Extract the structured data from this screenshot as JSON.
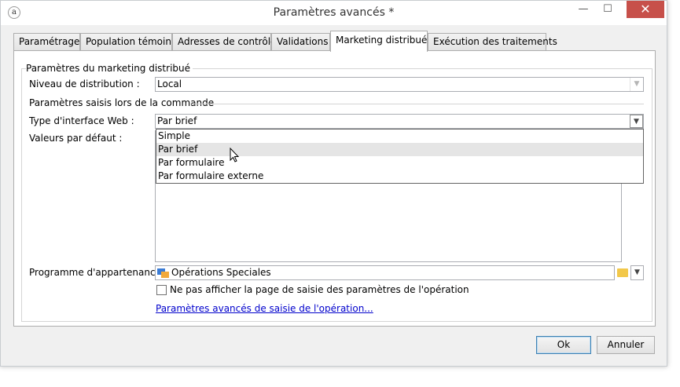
{
  "window": {
    "title": "Paramètres avancés *",
    "close_glyph": "✕",
    "minimize_glyph": "—",
    "maximize_glyph": "☐"
  },
  "tabs": [
    {
      "label": "Paramétrage"
    },
    {
      "label": "Population témoin"
    },
    {
      "label": "Adresses de contrôle"
    },
    {
      "label": "Validations"
    },
    {
      "label": "Marketing distribué",
      "active": true
    },
    {
      "label": "Exécution des traitements"
    }
  ],
  "distributed": {
    "section_title": "Paramètres du marketing distribué",
    "level_label": "Niveau de distribution :",
    "level_value": "Local"
  },
  "order": {
    "section_title": "Paramètres saisis lors de la commande",
    "web_type_label": "Type d'interface Web :",
    "web_type_value": "Par brief",
    "defaults_label": "Valeurs par défaut :",
    "dropdown_options": [
      "Simple",
      "Par brief",
      "Par formulaire",
      "Par formulaire externe"
    ],
    "hovered_option": "Par brief"
  },
  "program": {
    "label": "Programme d'appartenance :",
    "value": "Opérations Speciales"
  },
  "hide_page_checkbox": {
    "label": "Ne pas afficher la page de saisie des paramètres de l'opération",
    "checked": false
  },
  "advanced_link": "Paramètres avancés de saisie de l'opération...",
  "buttons": {
    "ok": "Ok",
    "cancel": "Annuler"
  },
  "colors": {
    "close_button": "#c7504a",
    "link": "#0000cc",
    "folder": "#f2c84a"
  }
}
